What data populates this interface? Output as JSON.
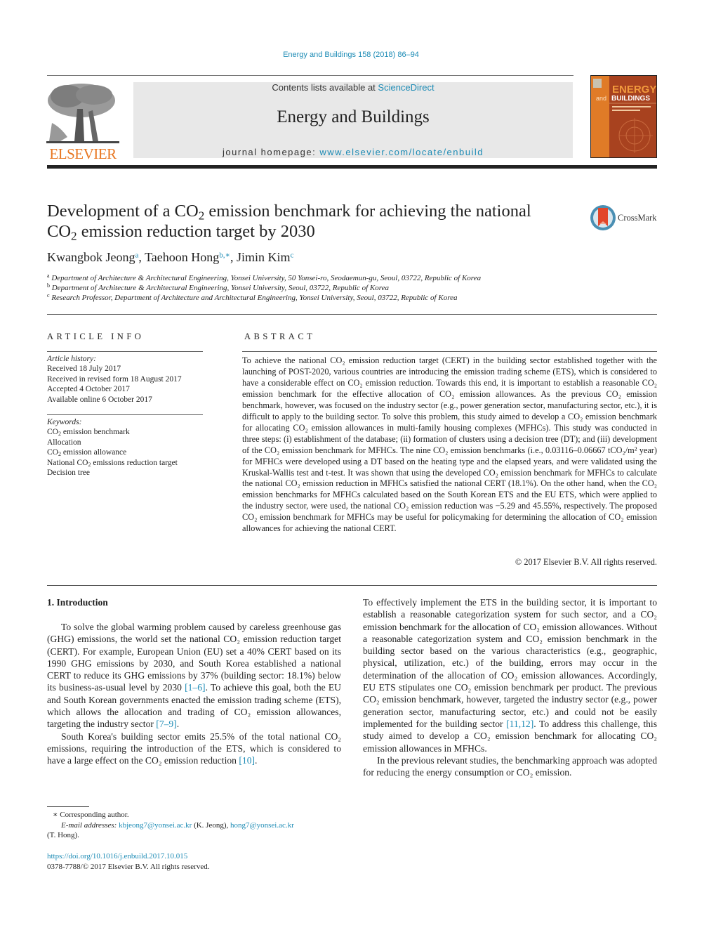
{
  "header": {
    "journal_ref": "Energy and Buildings 158 (2018) 86–94",
    "contents_prefix": "Contents lists available at ",
    "contents_link": "ScienceDirect",
    "journal_name": "Energy and Buildings",
    "homepage_prefix": "journal homepage: ",
    "homepage_link": "www.elsevier.com/locate/enbuild",
    "publisher_logo": "ELSEVIER",
    "cover": {
      "line1": "ENERGY",
      "line2_prefix": "and",
      "line2": "BUILDINGS"
    },
    "accent_color": "#1c8bb5",
    "elsevier_color": "#e87722"
  },
  "article": {
    "title_part1": "Development of a CO",
    "title_sub": "2",
    "title_part2": " emission benchmark for achieving the national",
    "title_line2_part1": "CO",
    "title_line2_sub": "2",
    "title_line2_part2": " emission reduction target by 2030",
    "crossmark_label": "CrossMark",
    "authors": [
      {
        "name": "Kwangbok Jeong",
        "marks": "a"
      },
      {
        "name": "Taehoon Hong",
        "marks": "b,∗"
      },
      {
        "name": "Jimin Kim",
        "marks": "c"
      }
    ],
    "affiliations": [
      {
        "mark": "a",
        "text": "Department of Architecture & Architectural Engineering, Yonsei University, 50 Yonsei-ro, Seodaemun-gu, Seoul, 03722, Republic of Korea"
      },
      {
        "mark": "b",
        "text": "Department of Architecture & Architectural Engineering, Yonsei University, Seoul, 03722, Republic of Korea"
      },
      {
        "mark": "c",
        "text": "Research Professor, Department of Architecture and Architectural Engineering, Yonsei University, Seoul, 03722, Republic of Korea"
      }
    ]
  },
  "article_info": {
    "heading": "ARTICLE INFO",
    "history_label": "Article history:",
    "history": [
      "Received 18 July 2017",
      "Received in revised form 18 August 2017",
      "Accepted 4 October 2017",
      "Available online 6 October 2017"
    ],
    "keywords_label": "Keywords:",
    "keywords": [
      {
        "pre": "CO",
        "sub": "2",
        "post": " emission benchmark"
      },
      {
        "pre": "Allocation",
        "sub": "",
        "post": ""
      },
      {
        "pre": "CO",
        "sub": "2",
        "post": " emission allowance"
      },
      {
        "pre": "National CO",
        "sub": "2",
        "post": " emissions reduction target"
      },
      {
        "pre": "Decision tree",
        "sub": "",
        "post": ""
      }
    ]
  },
  "abstract": {
    "heading": "ABSTRACT",
    "text": "To achieve the national CO₂ emission reduction target (CERT) in the building sector established together with the launching of POST-2020, various countries are introducing the emission trading scheme (ETS), which is considered to have a considerable effect on CO₂ emission reduction. Towards this end, it is important to establish a reasonable CO₂ emission benchmark for the effective allocation of CO₂ emission allowances. As the previous CO₂ emission benchmark, however, was focused on the industry sector (e.g., power generation sector, manufacturing sector, etc.), it is difficult to apply to the building sector. To solve this problem, this study aimed to develop a CO₂ emission benchmark for allocating CO₂ emission allowances in multi-family housing complexes (MFHCs). This study was conducted in three steps: (i) establishment of the database; (ii) formation of clusters using a decision tree (DT); and (iii) development of the CO₂ emission benchmark for MFHCs. The nine CO₂ emission benchmarks (i.e., 0.03116–0.06667 tCO₂/m² year) for MFHCs were developed using a DT based on the heating type and the elapsed years, and were validated using the Kruskal-Wallis test and t-test. It was shown that using the developed CO₂ emission benchmark for MFHCs to calculate the national CO₂ emission reduction in MFHCs satisfied the national CERT (18.1%). On the other hand, when the CO₂ emission benchmarks for MFHCs calculated based on the South Korean ETS and the EU ETS, which were applied to the industry sector, were used, the national CO₂ emission reduction was −5.29 and 45.55%, respectively. The proposed CO₂ emission benchmark for MFHCs may be useful for policymaking for determining the allocation of CO₂ emission allowances for achieving the national CERT.",
    "copyright": "© 2017 Elsevier B.V. All rights reserved."
  },
  "introduction": {
    "heading": "1.  Introduction",
    "left_paragraphs": [
      {
        "segments": [
          {
            "t": "To solve the global warming problem caused by careless greenhouse gas (GHG) emissions, the world set the national CO₂ emission reduction target (CERT). For example, European Union (EU) set a 40% CERT based on its 1990 GHG emissions by 2030, and South Korea established a national CERT to reduce its GHG emissions by 37% (building sector: 18.1%) below its business-as-usual level by 2030 "
          },
          {
            "t": "[1–6]",
            "link": true
          },
          {
            "t": ". To achieve this goal, both the EU and South Korean governments enacted the emission trading scheme (ETS), which allows the allocation and trading of CO₂ emission allowances, targeting the industry sector "
          },
          {
            "t": "[7–9]",
            "link": true
          },
          {
            "t": "."
          }
        ]
      },
      {
        "segments": [
          {
            "t": "South Korea's building sector emits 25.5% of the total national CO₂ emissions, requiring the introduction of the ETS, which is considered to have a large effect on the CO₂ emission reduction "
          },
          {
            "t": "[10]",
            "link": true
          },
          {
            "t": "."
          }
        ]
      }
    ],
    "right_paragraphs": [
      {
        "segments": [
          {
            "t": "To effectively implement the ETS in the building sector, it is important to establish a reasonable categorization system for such sector, and a CO₂ emission benchmark for the allocation of CO₂ emission allowances. Without a reasonable categorization system and CO₂ emission benchmark in the building sector based on the various characteristics (e.g., geographic, physical, utilization, etc.) of the building, errors may occur in the determination of the allocation of CO₂ emission allowances. Accordingly, EU ETS stipulates one CO₂ emission benchmark per product. The previous CO₂ emission benchmark, however, targeted the industry sector (e.g., power generation sector, manufacturing sector, etc.) and could not be easily implemented for the building sector "
          },
          {
            "t": "[11,12]",
            "link": true
          },
          {
            "t": ". To address this challenge, this study aimed to develop a CO₂ emission benchmark for allocating CO₂ emission allowances in MFHCs."
          }
        ]
      },
      {
        "segments": [
          {
            "t": "In the previous relevant studies, the benchmarking approach was adopted for reducing the energy consumption or CO₂ emission."
          }
        ]
      }
    ]
  },
  "footnotes": {
    "corresponding": "∗  Corresponding author.",
    "email_label": "E-mail addresses: ",
    "email1": "kbjeong7@yonsei.ac.kr",
    "email1_owner": " (K. Jeong), ",
    "email2": "hong7@yonsei.ac.kr",
    "email2_owner": "(T. Hong).",
    "doi": "https://doi.org/10.1016/j.enbuild.2017.10.015",
    "issn_rights": "0378-7788/© 2017 Elsevier B.V. All rights reserved."
  }
}
